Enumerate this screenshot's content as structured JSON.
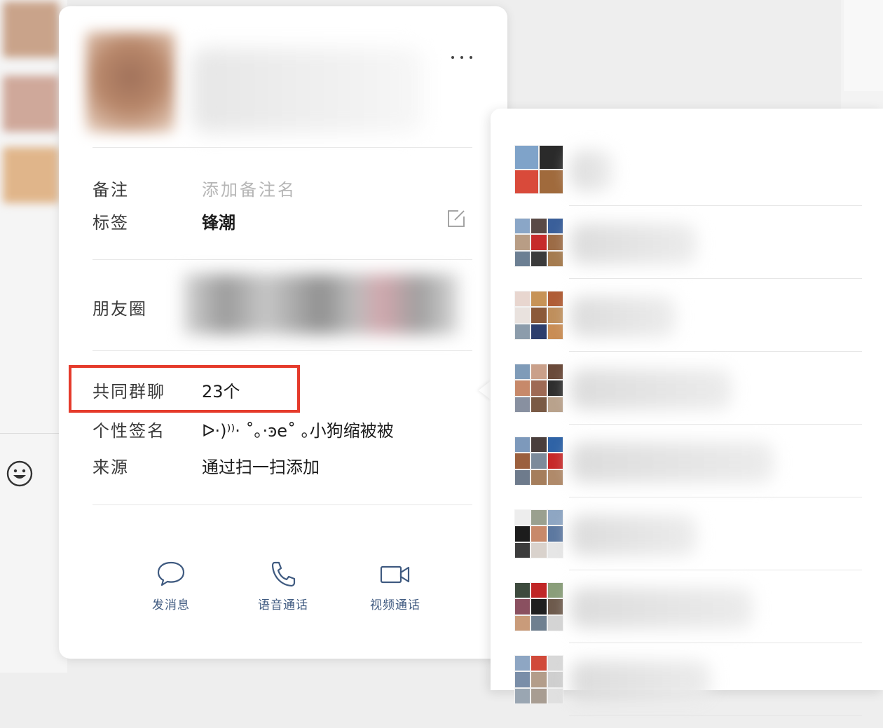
{
  "profile": {
    "name": "",
    "more_icon": "more-dots-icon",
    "remark_label": "备注",
    "remark_placeholder": "添加备注名",
    "tag_label": "标签",
    "tag_value": "锋潮",
    "edit_icon": "edit-icon",
    "moments_label": "朋友圈",
    "common_groups_label": "共同群聊",
    "common_groups_value": "23个",
    "signature_label": "个性签名",
    "signature_value": "ᐅ·)⁾⁾· ˚｡·ꜿe˚ ｡小狗缩被被",
    "source_label": "来源",
    "source_value": "通过扫一扫添加",
    "highlight_color": "#e53b2c"
  },
  "actions": [
    {
      "label": "发消息",
      "icon": "chat-bubble-icon"
    },
    {
      "label": "语音通话",
      "icon": "phone-icon"
    },
    {
      "label": "视频通话",
      "icon": "video-camera-icon"
    }
  ],
  "accent_color": "#3f5a80",
  "groups": [
    {
      "name": "",
      "avatar_cells": [
        "#7fa3c9",
        "#2a2a2a",
        "#d94a3a",
        "#a06a3c"
      ]
    },
    {
      "name": "",
      "avatar_cells": [
        "#8aa6c7",
        "#5a4a46",
        "#3a5f9a",
        "#b89d85",
        "#c62b2b",
        "#9c6b45",
        "#6c7f93",
        "#3b3b3b",
        "#a57b4f"
      ]
    },
    {
      "name": "",
      "avatar_cells": [
        "#e8d6cf",
        "#c79356",
        "#b05d36",
        "#e9e2de",
        "#8b5a3a",
        "#bf8f5c",
        "#8c9cab",
        "#2d3e6c",
        "#c98d55"
      ]
    },
    {
      "name": "",
      "avatar_cells": [
        "#7f9bb8",
        "#caa08a",
        "#6a4a3a",
        "#c7896a",
        "#9e6a55",
        "#2e2e2e",
        "#8890a0",
        "#7a5a45",
        "#b9a28c"
      ]
    },
    {
      "name": "",
      "avatar_cells": [
        "#7d99bb",
        "#4a3e3c",
        "#2f63a6",
        "#9b5f3d",
        "#7c8b9b",
        "#c72828",
        "#6e7b8c",
        "#a57e5c",
        "#b08a6a"
      ]
    },
    {
      "name": "",
      "avatar_cells": [
        "#ededed",
        "#9aa08f",
        "#8ea6c3",
        "#1c1c1c",
        "#c8896a",
        "#5c78a0",
        "#3c3c3c",
        "#d9d2cc",
        "#e6e6e6"
      ]
    },
    {
      "name": "",
      "avatar_cells": [
        "#3d4a3d",
        "#c02626",
        "#8a9e7a",
        "#8a5060",
        "#1f1f1f",
        "#6d5a4c",
        "#c99b7a",
        "#6f8090",
        "#d4d4d4"
      ]
    },
    {
      "name": "",
      "avatar_cells": [
        "#8ea6c3",
        "#d14a3a",
        "#d8d8d8",
        "#7a8ea8",
        "#b39d8a",
        "#cfcfcf",
        "#9aa6b2",
        "#a89d92",
        "#e0e0e0"
      ]
    }
  ]
}
